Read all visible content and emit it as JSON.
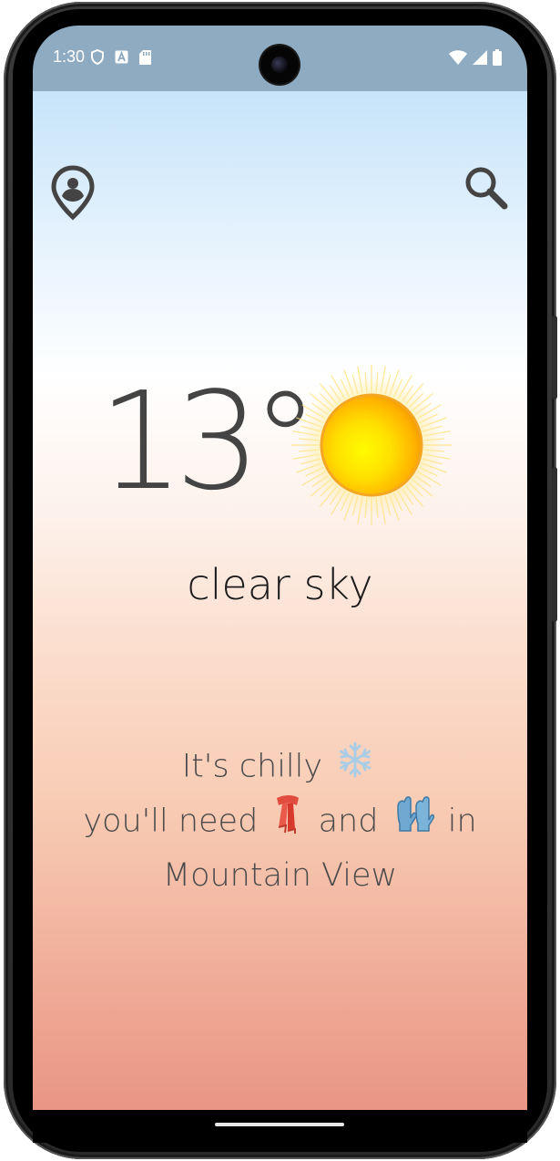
{
  "status_bar": {
    "time": "1:30",
    "left_icons": [
      "shield-icon",
      "a-badge-icon",
      "sd-card-icon"
    ],
    "right_icons": [
      "wifi-icon",
      "signal-icon",
      "battery-icon"
    ],
    "background": "#8fabc1"
  },
  "header": {
    "left_icon": "location-pin-icon",
    "right_icon": "search-icon"
  },
  "weather": {
    "temperature": "13°",
    "icon": "sun-icon",
    "condition": "clear sky"
  },
  "advice": {
    "line1_text": "It's chilly",
    "line1_emoji": "snowflake-icon",
    "line2_prefix": "you'll need",
    "line2_emoji1": "scarf-icon",
    "line2_middle": "and",
    "line2_emoji2": "gloves-icon",
    "line2_suffix": "in",
    "line3_text": "Mountain View"
  },
  "colors": {
    "gradient_top": "#c7e4fa",
    "gradient_mid": "#ffffff",
    "gradient_bottom": "#e99584",
    "text_primary": "#444444"
  }
}
